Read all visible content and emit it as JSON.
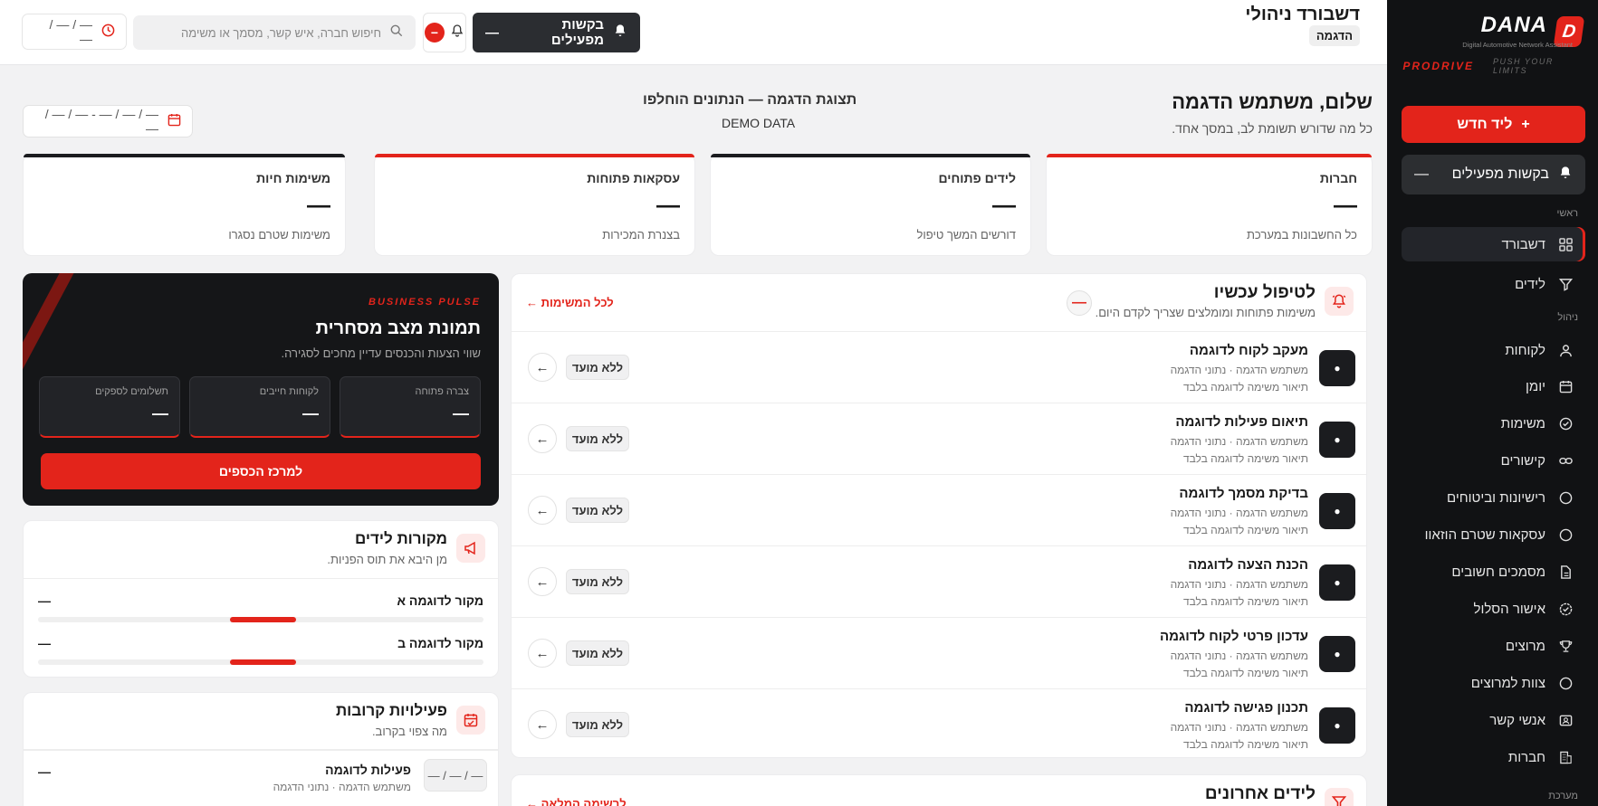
{
  "sidebar": {
    "brand_name": "DANA",
    "brand_letter": "D",
    "brand_sub": "Digital Automotive Network Assistant",
    "brand_prodrive": "PRODRIVE",
    "brand_limits": "PUSH YOUR LIMITS",
    "new_lead": "ליד חדש",
    "requests": "בקשות מפעילים",
    "requests_value": "—",
    "sections": {
      "main": "ראשי",
      "manage": "ניהול",
      "system": "מערכת"
    },
    "items": [
      {
        "label": "דשבורד",
        "icon": "grid-icon"
      },
      {
        "label": "לידים",
        "icon": "funnel-icon"
      },
      {
        "label": "לקוחות",
        "icon": "user-icon"
      },
      {
        "label": "יומן",
        "icon": "calendar-icon"
      },
      {
        "label": "משימות",
        "icon": "check-circle-icon"
      },
      {
        "label": "קישורים",
        "icon": "link-icon"
      },
      {
        "label": "רישיונות וביטוחים",
        "icon": "circle-icon"
      },
      {
        "label": "עסקאות שטרם הוזאוו",
        "icon": "circle-icon"
      },
      {
        "label": "מסמכים חשובים",
        "icon": "document-icon"
      },
      {
        "label": "אישור הסלול",
        "icon": "badge-check-icon"
      },
      {
        "label": "מרוצים",
        "icon": "trophy-icon"
      },
      {
        "label": "צוות למרוצים",
        "icon": "circle-icon"
      },
      {
        "label": "אנשי קשר",
        "icon": "contact-card-icon"
      },
      {
        "label": "חברות",
        "icon": "building-icon"
      }
    ]
  },
  "topbar": {
    "title": "דשבורד ניהולי",
    "chip": "הדגמה",
    "requests": "בקשות מפעילים",
    "requests_value": "—",
    "search_placeholder": "חיפוש חברה, איש קשר, מסמך או משימה",
    "date_value": "— / — / —"
  },
  "header": {
    "greeting": "שלום, משתמש הדגמה",
    "greeting_sub": "כל מה שדורש תשומת לב, במסך אחד.",
    "center_title": "תצוגת הדגמה — הנתונים הוחלפו",
    "center_sub": "DEMO DATA",
    "date_range": "— / — / — - — / — / —"
  },
  "kpis": [
    {
      "title": "חברות",
      "value": "—",
      "sub": "כל החשבונות במערכת",
      "accent": "red"
    },
    {
      "title": "לידים פתוחים",
      "value": "—",
      "sub": "דורשים המשך טיפול",
      "accent": "dark"
    },
    {
      "title": "עסקאות פתוחות",
      "value": "—",
      "sub": "בצנרת המכירות",
      "accent": "red"
    },
    {
      "title": "משימות חיות",
      "value": "—",
      "sub": "משימות שטרם נסגרו",
      "accent": "dark"
    }
  ],
  "tasks": {
    "title": "לטיפול עכשיו",
    "subtitle": "משימות פתוחות ומומלצים שצריך לקדם היום.",
    "badge": "—",
    "link": "לכל המשימות ←",
    "rows": [
      {
        "title": "מעקב לקוח לדוגמה",
        "meta": "משתמש הדגמה · נתוני הדגמה",
        "desc": "תיאור משימה לדוגמה בלבד",
        "tag": "ללא מועד"
      },
      {
        "title": "תיאום פעילות לדוגמה",
        "meta": "משתמש הדגמה · נתוני הדגמה",
        "desc": "תיאור משימה לדוגמה בלבד",
        "tag": "ללא מועד"
      },
      {
        "title": "בדיקת מסמך לדוגמה",
        "meta": "משתמש הדגמה · נתוני הדגמה",
        "desc": "תיאור משימה לדוגמה בלבד",
        "tag": "ללא מועד"
      },
      {
        "title": "הכנת הצעה לדוגמה",
        "meta": "משתמש הדגמה · נתוני הדגמה",
        "desc": "תיאור משימה לדוגמה בלבד",
        "tag": "ללא מועד"
      },
      {
        "title": "עדכון פרטי לקוח לדוגמה",
        "meta": "משתמש הדגמה · נתוני הדגמה",
        "desc": "תיאור משימה לדוגמה בלבד",
        "tag": "ללא מועד"
      },
      {
        "title": "תכנון פגישה לדוגמה",
        "meta": "משתמש הדגמה · נתוני הדגמה",
        "desc": "תיאור משימה לדוגמה בלבד",
        "tag": "ללא מועד"
      }
    ]
  },
  "leads": {
    "title": "לידים אחרונים",
    "link": "לרשימה המלאה ←"
  },
  "pulse": {
    "eyebrow": "BUSINESS PULSE",
    "title": "תמונת מצב מסחרית",
    "subtitle": "שווי הצעות והכנסים עדיין מחכים לסגירה.",
    "boxes": [
      {
        "label": "צברה פתוחה",
        "value": "—"
      },
      {
        "label": "לקוחות חייבים",
        "value": "—"
      },
      {
        "label": "תשלומים לספקים",
        "value": "—"
      }
    ],
    "button": "למרכז הכספים"
  },
  "sources": {
    "title": "מקורות לידים",
    "subtitle": "מן היבא את תוס הפניות.",
    "rows": [
      {
        "label": "מקור לדוגמה א",
        "value": "—",
        "share": 0.15
      },
      {
        "label": "מקור לדוגמה ב",
        "value": "—",
        "share": 0.15
      }
    ]
  },
  "activities": {
    "title": "פעילויות קרובות",
    "subtitle": "מה צפוי בקרוב.",
    "rows": [
      {
        "date": "— / — / —",
        "title": "פעילות לדוגמה",
        "meta": "משתמש הדגמה · נתוני הדגמה",
        "value": "—"
      }
    ]
  }
}
